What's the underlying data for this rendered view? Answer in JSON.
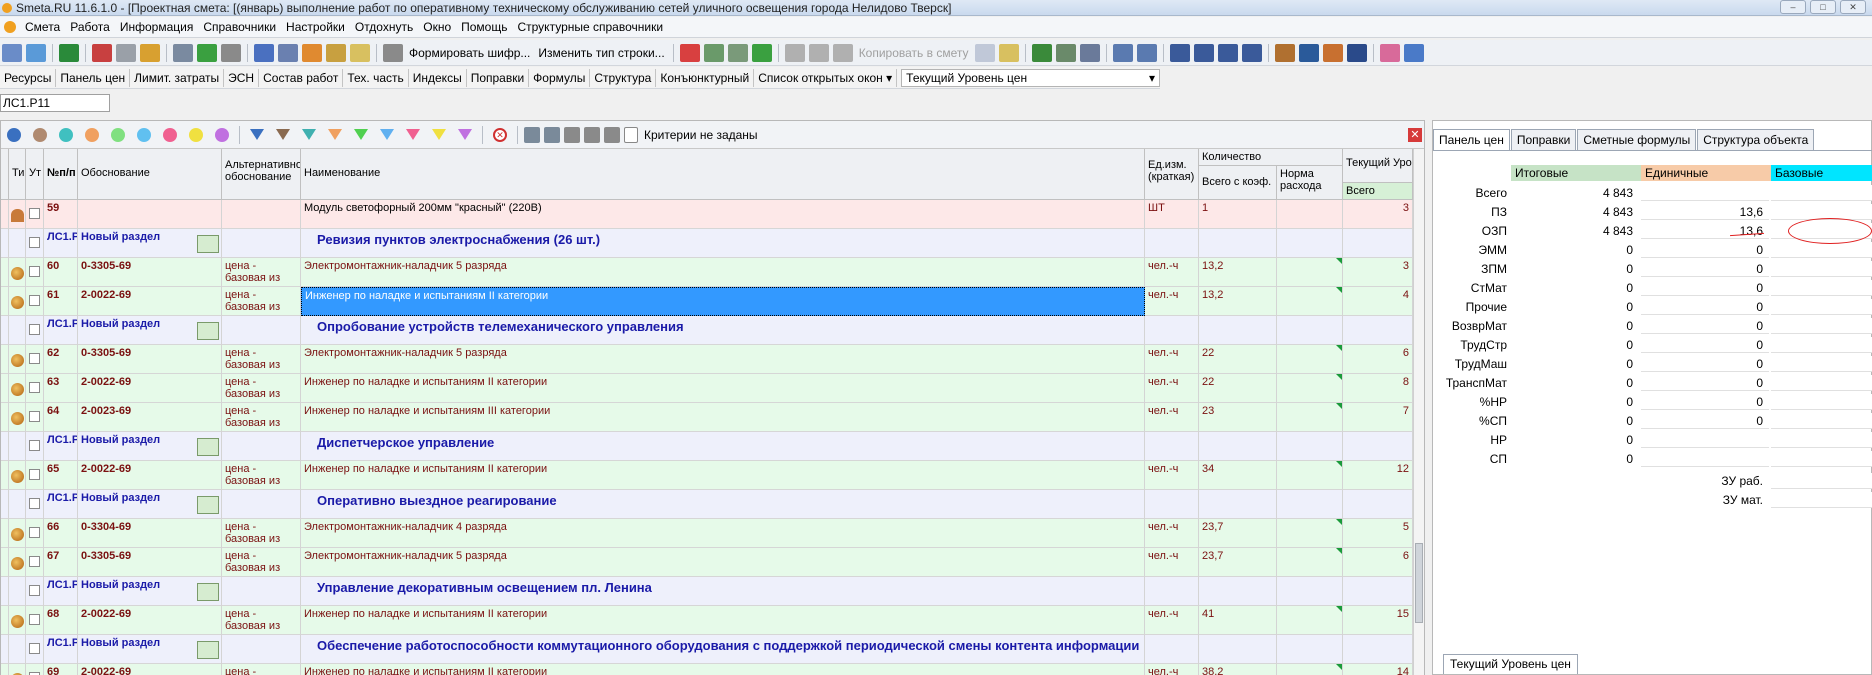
{
  "titlebar": {
    "text": "Smeta.RU  11.6.1.0  - [Проектная смета:  [(январь) выполнение работ по оперативному техническому обслуживанию сетей уличного освещения города Нелидово Тверск]"
  },
  "menu": [
    "Смета",
    "Работа",
    "Информация",
    "Справочники",
    "Настройки",
    "Отдохнуть",
    "Окно",
    "Помощь",
    "Структурные справочники"
  ],
  "toolbar1": {
    "form_cipher": "Формировать шифр...",
    "change_row_type": "Изменить тип строки...",
    "copy_to_estimate": "Копировать в смету"
  },
  "toolbar2": [
    "Ресурсы",
    "Панель цен",
    "Лимит. затраты",
    "ЭСН",
    "Состав работ",
    "Тех. часть",
    "Индексы",
    "Поправки",
    "Формулы",
    "Структура",
    "Конъюнктурный"
  ],
  "toolbar2_open_windows": "Список открытых окон",
  "toolbar2_level": "Текущий Уровень цен",
  "crumb": "ЛС1.Р11",
  "filter": {
    "criteria": "Критерии не заданы"
  },
  "grid": {
    "headers": {
      "type": "Ти",
      "ut": "Ут",
      "num": "№п/п",
      "basis": "Обоснование",
      "alt": "Альтернативное обоснование",
      "name": "Наименование",
      "unit": "Ед.изм. (краткая)",
      "qty": "Количество",
      "qty_coef": "Всего с коэф.",
      "norm": "Норма расхода",
      "level": "Текущий Уровень",
      "total": "Всего"
    },
    "rows": [
      {
        "kind": "res",
        "num": "59",
        "code": "",
        "alt": "",
        "name": "Модуль светофорный 200мм \"красный\" (220В)",
        "unit": "ШТ",
        "qty": "1",
        "total": "3"
      },
      {
        "kind": "sec",
        "ls": "ЛС1.Р",
        "code": "Новый раздел",
        "name": "Ревизия пунктов электроснабжения (26 шт.)"
      },
      {
        "kind": "item",
        "num": "60",
        "code": "0-3305-69",
        "alt": "цена - базовая из",
        "name": "Электромонтажник-наладчик 5 разряда",
        "unit": "чел.-ч",
        "qty": "13,2",
        "total": "3"
      },
      {
        "kind": "item",
        "num": "61",
        "code": "2-0022-69",
        "alt": "цена - базовая из",
        "name": "Инженер по наладке и испытаниям II категории",
        "unit": "чел.-ч",
        "qty": "13,2",
        "total": "4",
        "selected": true
      },
      {
        "kind": "sec",
        "ls": "ЛС1.Р",
        "code": "Новый раздел",
        "name": "Опробование устройств телемеханического управления"
      },
      {
        "kind": "item",
        "num": "62",
        "code": "0-3305-69",
        "alt": "цена - базовая из",
        "name": "Электромонтажник-наладчик 5 разряда",
        "unit": "чел.-ч",
        "qty": "22",
        "total": "6"
      },
      {
        "kind": "item",
        "num": "63",
        "code": "2-0022-69",
        "alt": "цена - базовая из",
        "name": "Инженер по наладке и испытаниям II категории",
        "unit": "чел.-ч",
        "qty": "22",
        "total": "8"
      },
      {
        "kind": "item",
        "num": "64",
        "code": "2-0023-69",
        "alt": "цена - базовая из",
        "name": "Инженер по наладке и испытаниям III категории",
        "unit": "чел.-ч",
        "qty": "23",
        "total": "7"
      },
      {
        "kind": "sec",
        "ls": "ЛС1.Р",
        "code": "Новый раздел",
        "name": "Диспетчерское управление"
      },
      {
        "kind": "item",
        "num": "65",
        "code": "2-0022-69",
        "alt": "цена - базовая из",
        "name": "Инженер по наладке и испытаниям II категории",
        "unit": "чел.-ч",
        "qty": "34",
        "total": "12"
      },
      {
        "kind": "sec",
        "ls": "ЛС1.Р",
        "code": "Новый раздел",
        "name": "Оперативно выездное реагирование"
      },
      {
        "kind": "item",
        "num": "66",
        "code": "0-3304-69",
        "alt": "цена - базовая из",
        "name": "Электромонтажник-наладчик 4 разряда",
        "unit": "чел.-ч",
        "qty": "23,7",
        "total": "5"
      },
      {
        "kind": "item",
        "num": "67",
        "code": "0-3305-69",
        "alt": "цена - базовая из",
        "name": "Электромонтажник-наладчик 5 разряда",
        "unit": "чел.-ч",
        "qty": "23,7",
        "total": "6"
      },
      {
        "kind": "sec",
        "ls": "ЛС1.Р",
        "code": "Новый раздел",
        "name": "Управление декоративным освещением пл. Ленина"
      },
      {
        "kind": "item",
        "num": "68",
        "code": "2-0022-69",
        "alt": "цена - базовая из",
        "name": "Инженер по наладке и испытаниям II категории",
        "unit": "чел.-ч",
        "qty": "41",
        "total": "15"
      },
      {
        "kind": "sec",
        "ls": "ЛС1.Р",
        "code": "Новый раздел",
        "name": "Обеспечение работоспособности коммутационного оборудования с поддержкой периодической смены контента информации"
      },
      {
        "kind": "item",
        "num": "69",
        "code": "2-0022-69",
        "alt": "цена -",
        "name": "Инженер по наладке и испытаниям II категории",
        "unit": "чел.-ч",
        "qty": "38,2",
        "total": "14"
      }
    ]
  },
  "right": {
    "tabs": [
      "Панель цен",
      "Поправки",
      "Сметные формулы",
      "Структура объекта"
    ],
    "columns": {
      "total": "Итоговые",
      "unit": "Единичные",
      "base": "Базовые"
    },
    "colors": {
      "total": "#c6e3c6",
      "unit": "#f7cba8",
      "base": "#00e5ff"
    },
    "rows": [
      {
        "label": "Всего",
        "total": "4 843",
        "unit": ""
      },
      {
        "label": "ПЗ",
        "total": "4 843",
        "unit": "13,6"
      },
      {
        "label": "ОЗП",
        "total": "4 843",
        "unit": "13,6"
      },
      {
        "label": "ЭММ",
        "total": "0",
        "unit": "0"
      },
      {
        "label": "ЗПМ",
        "total": "0",
        "unit": "0"
      },
      {
        "label": "СтМат",
        "total": "0",
        "unit": "0"
      },
      {
        "label": "Прочие",
        "total": "0",
        "unit": "0"
      },
      {
        "label": "ВозврМат",
        "total": "0",
        "unit": "0"
      },
      {
        "label": "ТрудСтр",
        "total": "0",
        "unit": "0"
      },
      {
        "label": "ТрудМаш",
        "total": "0",
        "unit": "0"
      },
      {
        "label": "ТранспМат",
        "total": "0",
        "unit": "0"
      },
      {
        "label": "%НР",
        "total": "0",
        "unit": "0"
      },
      {
        "label": "%СП",
        "total": "0",
        "unit": "0"
      },
      {
        "label": "НР",
        "total": "0",
        "unit": ""
      },
      {
        "label": "СП",
        "total": "0",
        "unit": ""
      }
    ],
    "zu_rab": "ЗУ раб.",
    "zu_mat": "ЗУ мат.",
    "bottom_tab": "Текущий Уровень цен"
  }
}
